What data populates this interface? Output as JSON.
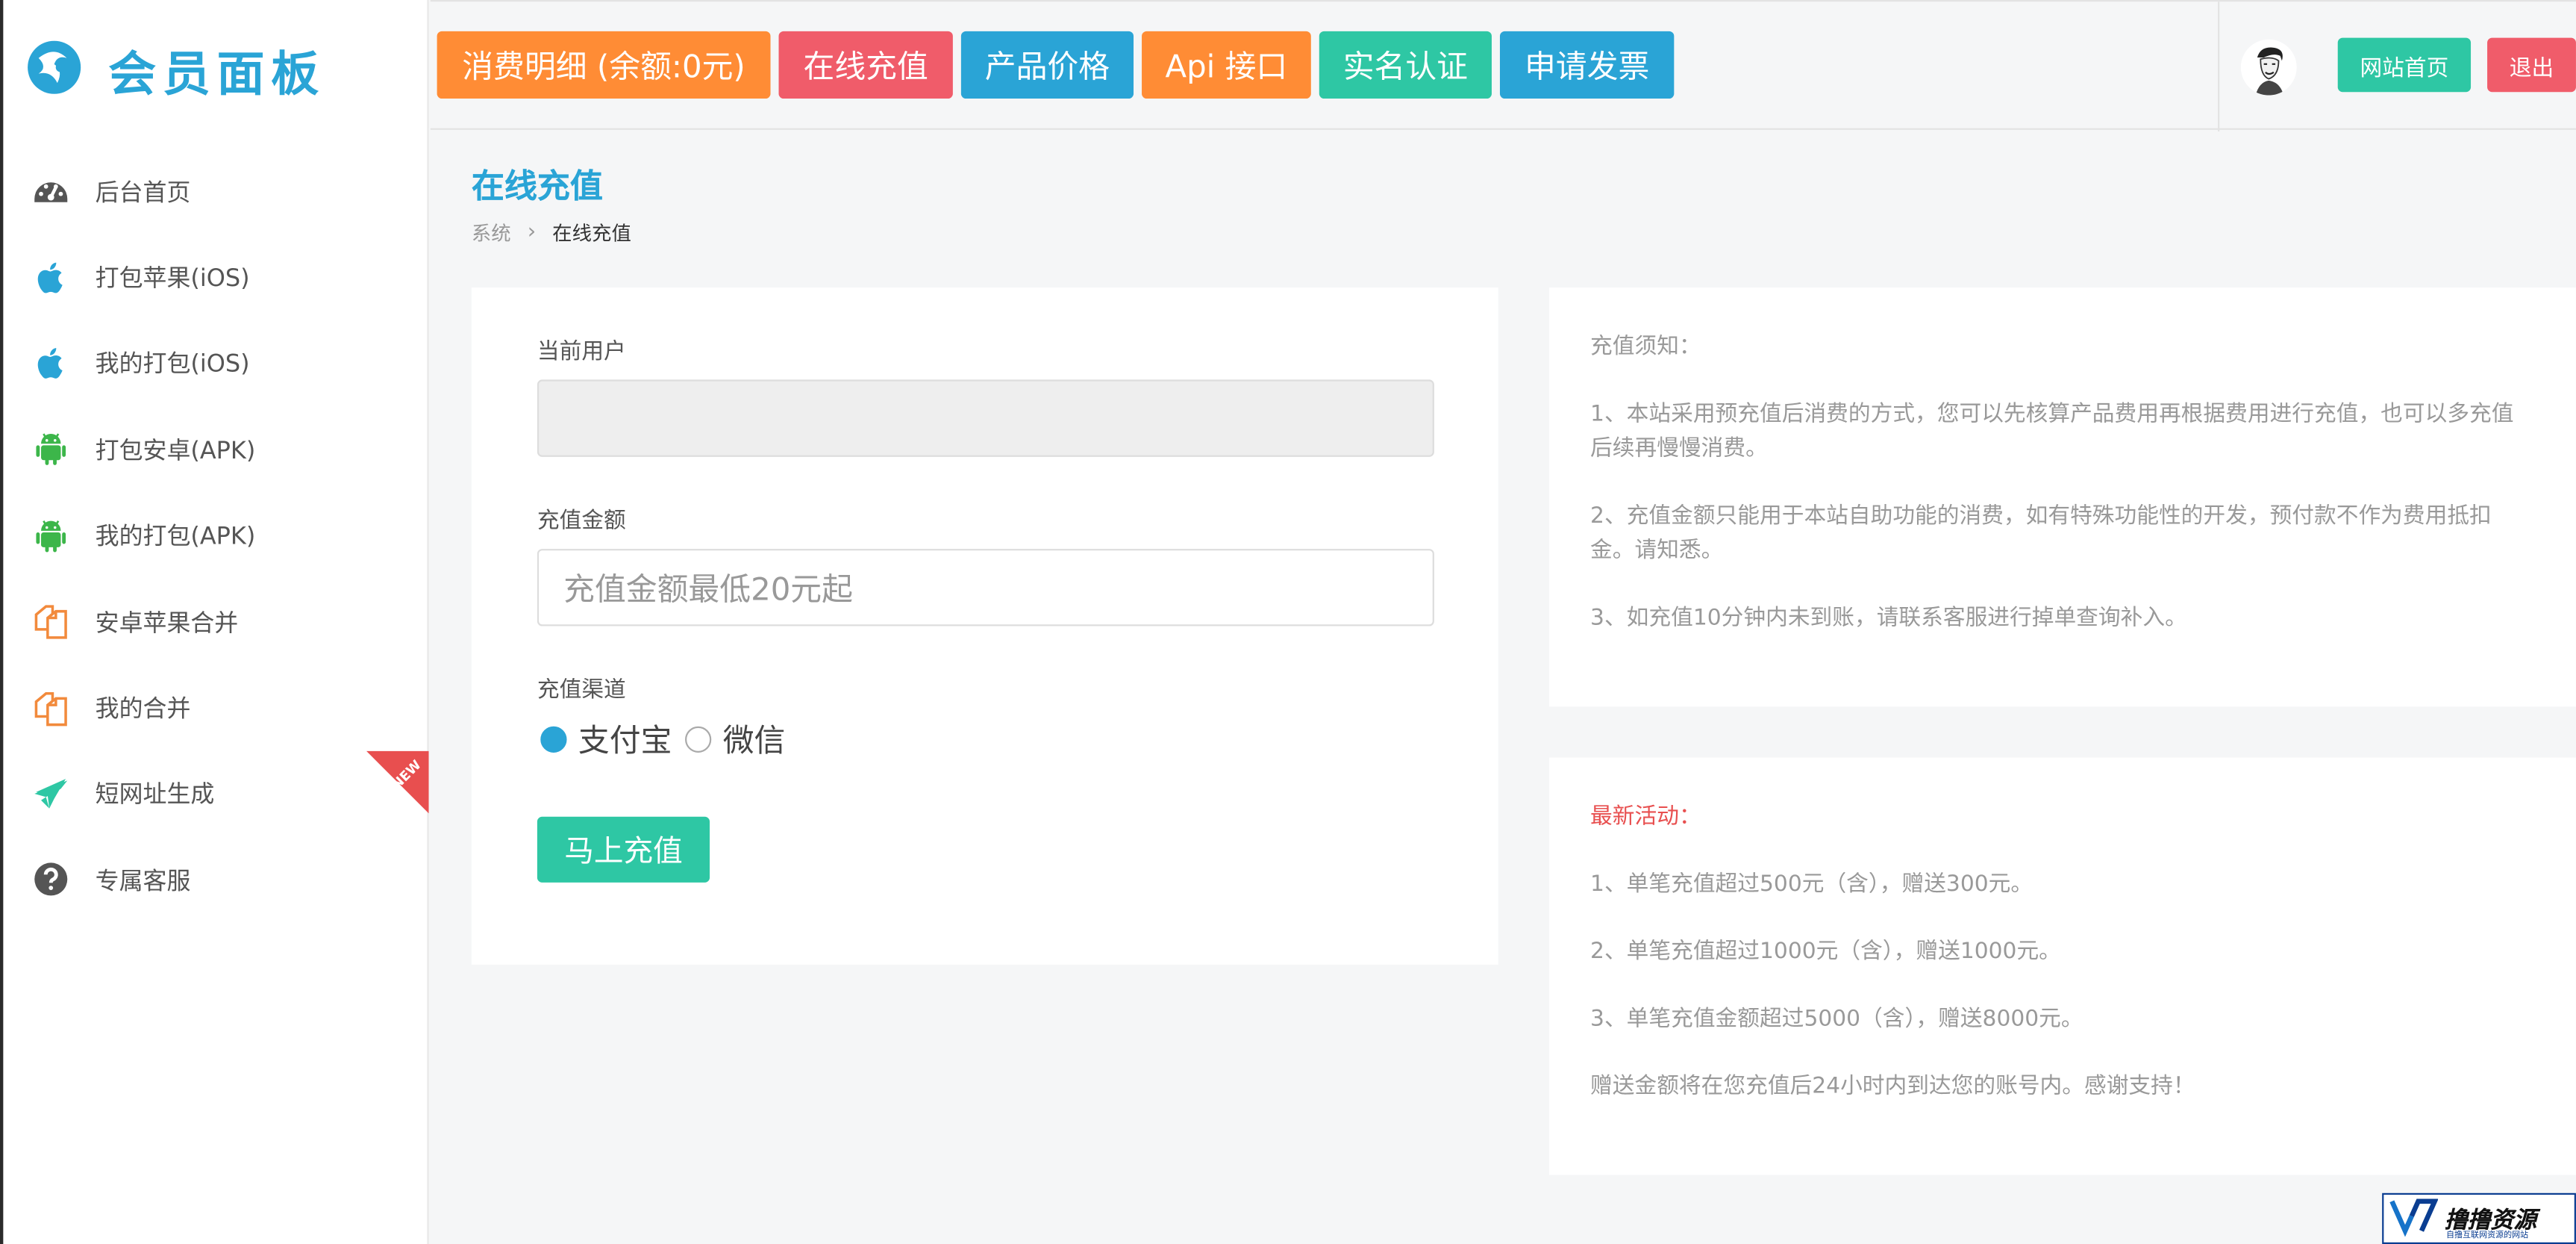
{
  "app": {
    "logo_text": "会员面板"
  },
  "colors": {
    "brand_blue": "#2aa4d6",
    "orange": "#ff8c35",
    "red": "#f05c6a",
    "teal": "#2ec7a4",
    "green_android": "#3cb64a",
    "merge_orange": "#f28a3c",
    "badge_red": "#e84f4f"
  },
  "sidebar": {
    "items": [
      {
        "label": "后台首页",
        "icon": "dashboard-icon"
      },
      {
        "label": "打包苹果(iOS)",
        "icon": "apple-icon"
      },
      {
        "label": "我的打包(iOS)",
        "icon": "apple-icon"
      },
      {
        "label": "打包安卓(APK)",
        "icon": "android-icon"
      },
      {
        "label": "我的打包(APK)",
        "icon": "android-icon"
      },
      {
        "label": "安卓苹果合并",
        "icon": "copy-icon"
      },
      {
        "label": "我的合并",
        "icon": "copy-icon"
      },
      {
        "label": "短网址生成",
        "icon": "plane-icon",
        "badge": "NEW"
      },
      {
        "label": "专属客服",
        "icon": "question-icon"
      }
    ]
  },
  "topbar": {
    "buttons": [
      {
        "label": "消费明细 (余额:0元)"
      },
      {
        "label": "在线充值"
      },
      {
        "label": "产品价格"
      },
      {
        "label": "Api 接口"
      },
      {
        "label": "实名认证"
      },
      {
        "label": "申请发票"
      }
    ],
    "home_label": "网站首页",
    "logout_label": "退出"
  },
  "page": {
    "title": "在线充值",
    "breadcrumb": {
      "parent": "系统",
      "current": "在线充值"
    }
  },
  "form": {
    "user_label": "当前用户",
    "user_value": "",
    "amount_label": "充值金额",
    "amount_placeholder": "充值金额最低20元起",
    "channel_label": "充值渠道",
    "channels": [
      {
        "label": "支付宝",
        "selected": true
      },
      {
        "label": "微信",
        "selected": false
      }
    ],
    "submit_label": "马上充值"
  },
  "notice": {
    "title": "充值须知：",
    "items": [
      "1、本站采用预充值后消费的方式，您可以先核算产品费用再根据费用进行充值，也可以多充值后续再慢慢消费。",
      "2、充值金额只能用于本站自助功能的消费，如有特殊功能性的开发，预付款不作为费用抵扣金。请知悉。",
      "3、如充值10分钟内未到账，请联系客服进行掉单查询补入。"
    ]
  },
  "promo": {
    "title": "最新活动：",
    "items": [
      "1、单笔充值超过500元（含），赠送300元。",
      "2、单笔充值超过1000元（含），赠送1000元。",
      "3、单笔充值金额超过5000（含），赠送8000元。",
      "赠送金额将在您充值后24小时内到达您的账号内。感谢支持！"
    ]
  },
  "watermark": {
    "main": "撸撸资源",
    "sub": "自撸互联网资源的网站"
  }
}
